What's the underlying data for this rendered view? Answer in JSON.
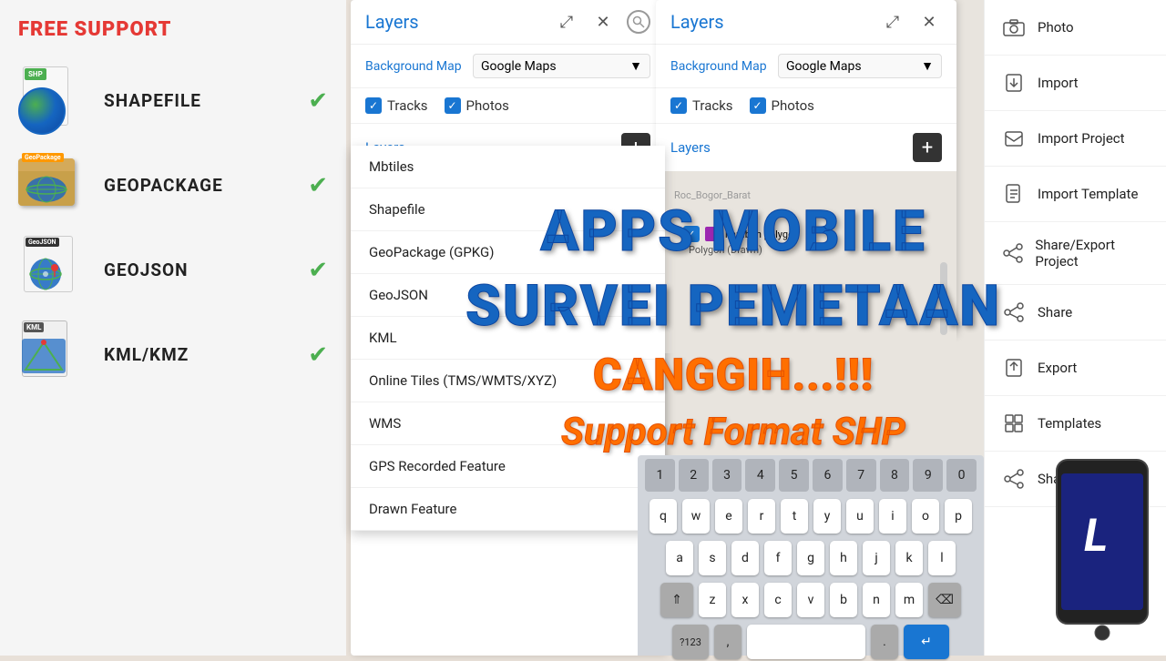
{
  "left_sidebar": {
    "free_support": "FREE SUPPORT",
    "formats": [
      {
        "name": "SHAPEFILE",
        "badge": "SHP",
        "badge_color": "#4CAF50",
        "icon_type": "shp"
      },
      {
        "name": "GEOPACKAGE",
        "badge": "GeoPackage",
        "badge_color": "#ff9800",
        "icon_type": "box"
      },
      {
        "name": "GEOJSON",
        "badge": "GeoJSON",
        "badge_color": "#333",
        "icon_type": "geojson"
      },
      {
        "name": "KML/KMZ",
        "badge": "KML",
        "badge_color": "#555",
        "icon_type": "kml"
      }
    ]
  },
  "panel1": {
    "title": "Layers",
    "background_map_label": "Background Map",
    "background_map_value": "Google Maps",
    "tracks_label": "Tracks",
    "photos_label": "Photos",
    "layers_label": "Layers",
    "expand_icon": "⤢",
    "close_icon": "✕",
    "search_icon": "🔍",
    "add_icon": "+"
  },
  "panel2": {
    "title": "Layers",
    "background_map_label": "Background Map",
    "background_map_value": "Google Maps",
    "tracks_label": "Tracks",
    "photos_label": "Photos",
    "layers_label": "Layers",
    "expand_icon": "⤢",
    "close_icon": "✕",
    "add_icon": "+"
  },
  "dropdown_menu": {
    "items": [
      "Mbtiles",
      "Shapefile",
      "GeoPackage (GPKG)",
      "GeoJSON",
      "KML",
      "Online Tiles (TMS/WMTS/XYZ)",
      "WMS",
      "GPS Recorded Feature",
      "Drawn Feature"
    ]
  },
  "right_menu": {
    "items": [
      {
        "label": "Photo",
        "icon": "📷"
      },
      {
        "label": "Import",
        "icon": "⬇"
      },
      {
        "label": "Import Project",
        "icon": "📥"
      },
      {
        "label": "Import Template",
        "icon": "📋"
      },
      {
        "label": "Share/Export Project",
        "icon": "↗"
      },
      {
        "label": "Share",
        "icon": "↗"
      },
      {
        "label": "Export",
        "icon": "↪"
      },
      {
        "label": "Templates",
        "icon": "📄"
      },
      {
        "label": "Share Template",
        "icon": "↗"
      }
    ]
  },
  "overlay": {
    "line1": "APPS MOBILE",
    "line2": "SURVEI PEMETAAN",
    "line3": "CANGGIH...!!!",
    "line4": "Support Format SHP"
  },
  "keyboard": {
    "num_row": [
      "1",
      "2",
      "3",
      "4",
      "5",
      "6",
      "7",
      "8",
      "9",
      "0"
    ],
    "row1": [
      "q",
      "w",
      "e",
      "r",
      "t",
      "y",
      "u",
      "i",
      "o",
      "p"
    ],
    "row2": [
      "a",
      "s",
      "d",
      "f",
      "g",
      "h",
      "j",
      "k",
      "l"
    ],
    "row3": [
      "z",
      "x",
      "c",
      "v",
      "b",
      "n",
      "m"
    ],
    "comma": ",",
    "period": ".",
    "enter_icon": "↵"
  }
}
